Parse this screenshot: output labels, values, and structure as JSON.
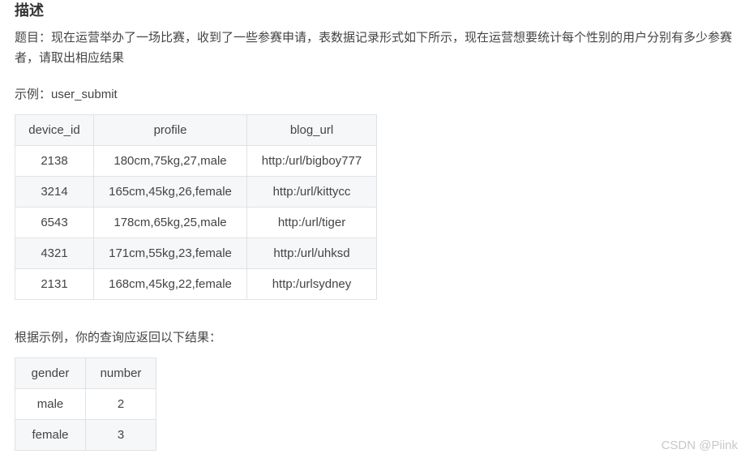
{
  "heading": "描述",
  "description": "题目：现在运营举办了一场比赛，收到了一些参赛申请，表数据记录形式如下所示，现在运营想要统计每个性别的用户分别有多少参赛者，请取出相应结果",
  "example_label": "示例：user_submit",
  "user_submit": {
    "columns": [
      "device_id",
      "profile",
      "blog_url"
    ],
    "rows": [
      [
        "2138",
        "180cm,75kg,27,male",
        "http:/url/bigboy777"
      ],
      [
        "3214",
        "165cm,45kg,26,female",
        "http:/url/kittycc"
      ],
      [
        "6543",
        "178cm,65kg,25,male",
        "http:/url/tiger"
      ],
      [
        "4321",
        "171cm,55kg,23,female",
        "http:/url/uhksd"
      ],
      [
        "2131",
        "168cm,45kg,22,female",
        "http:/urlsydney"
      ]
    ]
  },
  "result_label": "根据示例，你的查询应返回以下结果：",
  "result": {
    "columns": [
      "gender",
      "number"
    ],
    "rows": [
      [
        "male",
        "2"
      ],
      [
        "female",
        "3"
      ]
    ]
  },
  "watermark": "CSDN @Piink"
}
